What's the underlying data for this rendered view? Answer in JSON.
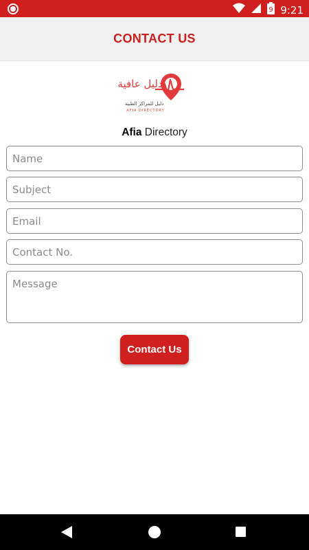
{
  "status_bar": {
    "time": "9:21",
    "battery_level": "9"
  },
  "app_bar": {
    "title": "CONTACT US"
  },
  "logo": {
    "arabic_title": "دليل عافية",
    "arabic_subtitle": "دليل للمراكز الطبية",
    "latin_text": "AFIA DIRECTORY"
  },
  "brand": {
    "bold": "Afia",
    "rest": " Directory"
  },
  "form": {
    "name_placeholder": "Name",
    "subject_placeholder": "Subject",
    "email_placeholder": "Email",
    "contact_placeholder": "Contact No.",
    "message_placeholder": "Message",
    "submit_label": "Contact Us"
  },
  "colors": {
    "accent": "#d01f1f",
    "appbar_bg": "#f1f1f1",
    "navbar_bg": "#000000"
  }
}
